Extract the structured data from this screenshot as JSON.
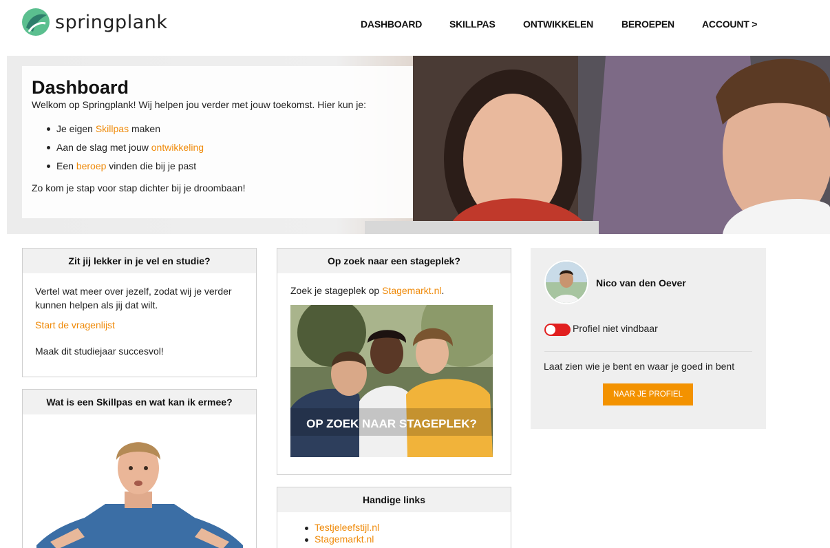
{
  "brand": {
    "name": "springplank"
  },
  "nav": {
    "items": [
      {
        "label": "DASHBOARD"
      },
      {
        "label": "SKILLPAS"
      },
      {
        "label": "ONTWIKKELEN"
      },
      {
        "label": "BEROEPEN"
      },
      {
        "label": "ACCOUNT >"
      }
    ]
  },
  "hero": {
    "title": "Dashboard",
    "intro": "Welkom op Springplank! Wij helpen jou verder met jouw toekomst. Hier kun je:",
    "list": [
      {
        "before": "Je eigen ",
        "link": "Skillpas",
        "after": " maken"
      },
      {
        "before": "Aan de slag met jouw ",
        "link": "ontwikkeling",
        "after": ""
      },
      {
        "before": "Een ",
        "link": "beroep",
        "after": " vinden die bij je past"
      }
    ],
    "outro": "Zo kom je stap voor stap dichter bij je droombaan!"
  },
  "card_wellbeing": {
    "title": "Zit jij lekker in je vel en studie?",
    "text": "Vertel wat meer over jezelf, zodat wij je verder kunnen helpen als jij dat wilt.",
    "link": "Start de vragenlijst",
    "footer": "Maak dit studiejaar succesvol!"
  },
  "card_skillpas": {
    "title": "Wat is een Skillpas en wat kan ik ermee?"
  },
  "card_internship": {
    "title": "Op zoek naar een stageplek?",
    "text_before": "Zoek je stageplek op ",
    "link": "Stagemarkt.nl",
    "text_after": ".",
    "image_caption": "OP ZOEK NAAR STAGEPLEK?"
  },
  "card_links": {
    "title": "Handige links",
    "links": [
      "Testjeleefstijl.nl",
      "Stagemarkt.nl"
    ]
  },
  "profile": {
    "name": "Nico van den Oever",
    "visibility_label": "Profiel niet vindbaar",
    "visibility_on": false,
    "tagline": "Laat zien wie je bent en waar je goed in bent",
    "button_label": "NAAR JE PROFIEL"
  },
  "colors": {
    "accent": "#ef8a09",
    "button": "#f39200",
    "toggle_off": "#e11f1f",
    "logo_green": "#4caf84"
  }
}
